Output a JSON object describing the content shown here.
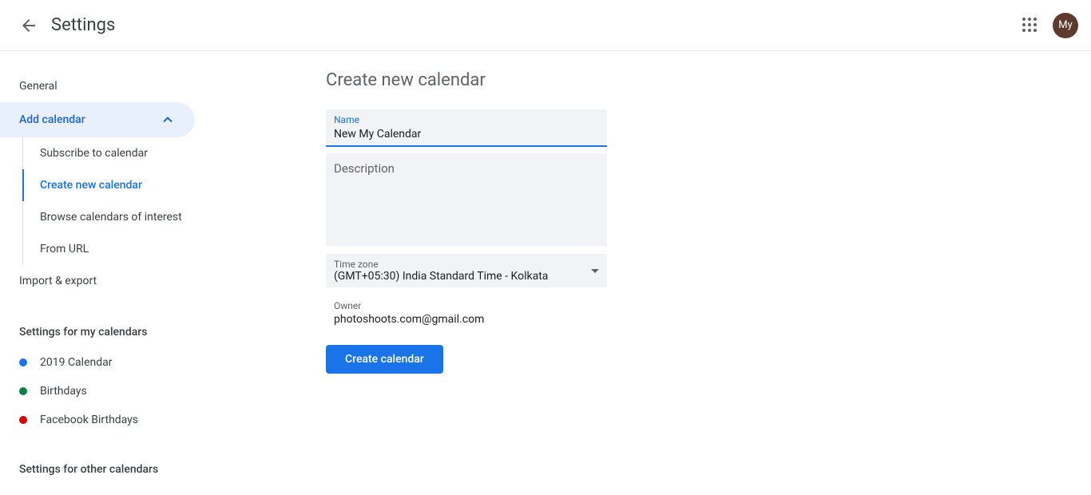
{
  "header": {
    "title": "Settings",
    "avatar_text": "My"
  },
  "sidebar": {
    "general": "General",
    "add_calendar": "Add calendar",
    "sub_items": [
      {
        "label": "Subscribe to calendar"
      },
      {
        "label": "Create new calendar"
      },
      {
        "label": "Browse calendars of interest"
      },
      {
        "label": "From URL"
      }
    ],
    "import_export": "Import & export",
    "my_calendars_header": "Settings for my calendars",
    "my_calendars": [
      {
        "label": "2019 Calendar",
        "color": "#1a73e8"
      },
      {
        "label": "Birthdays",
        "color": "#0b8043"
      },
      {
        "label": "Facebook Birthdays",
        "color": "#d50000"
      }
    ],
    "other_calendars_header": "Settings for other calendars"
  },
  "main": {
    "title": "Create new calendar",
    "name_label": "Name",
    "name_value": "New My Calendar",
    "description_label": "Description",
    "timezone_label": "Time zone",
    "timezone_value": "(GMT+05:30) India Standard Time - Kolkata",
    "owner_label": "Owner",
    "owner_value": "photoshoots.com@gmail.com",
    "create_button": "Create calendar"
  }
}
